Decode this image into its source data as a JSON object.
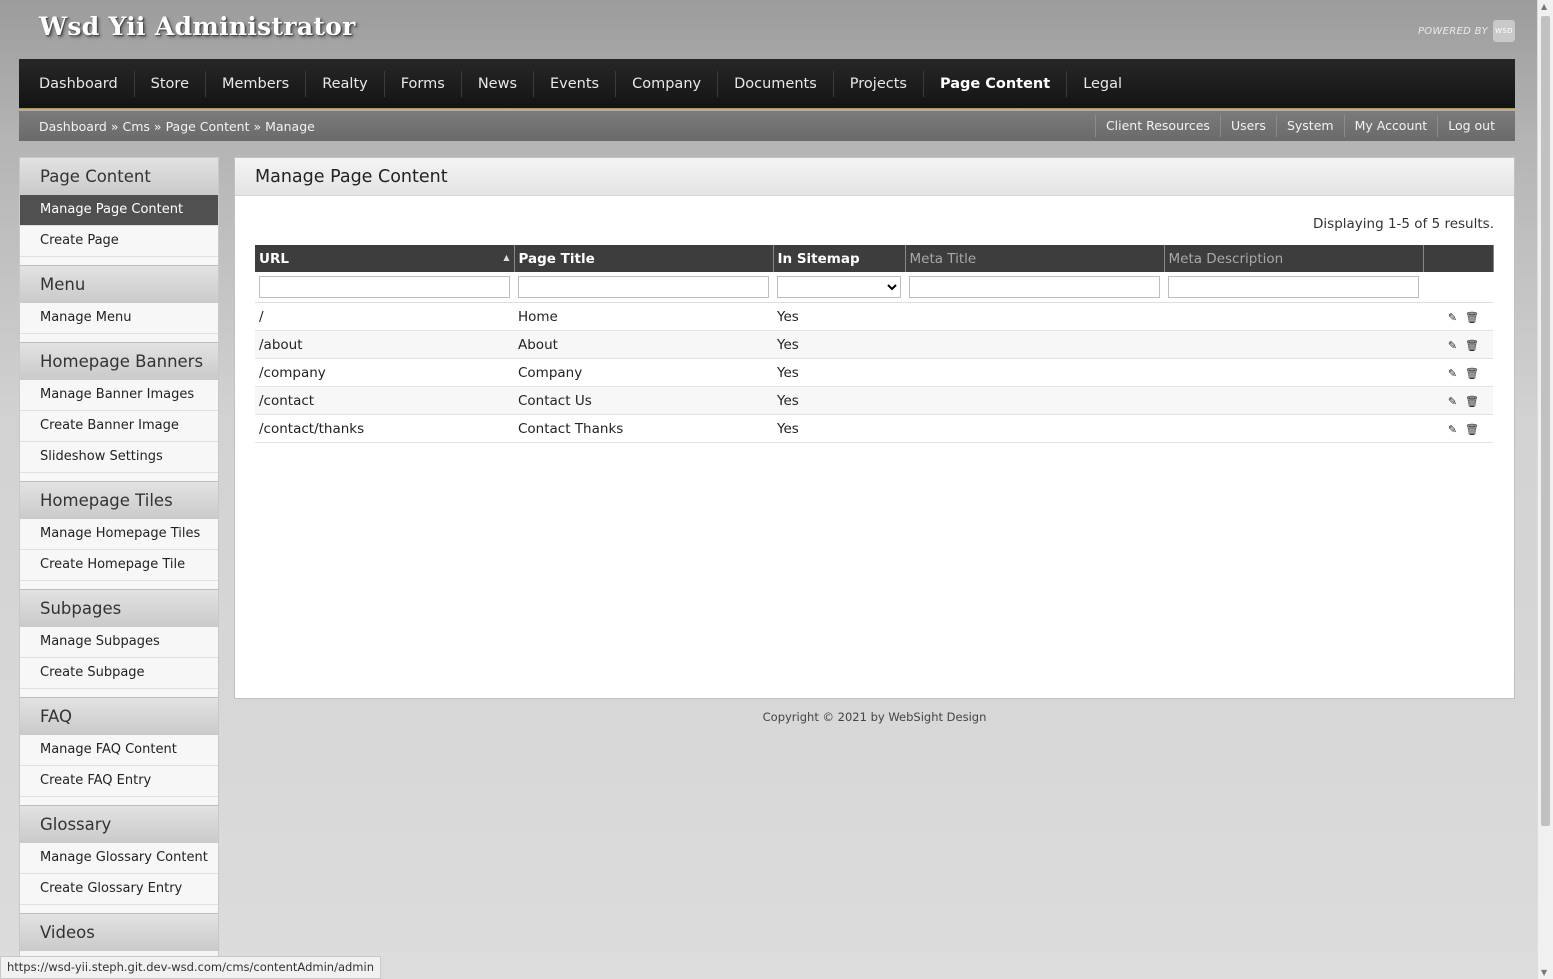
{
  "app": {
    "title": "Wsd Yii Administrator",
    "powered_by": "POWERED BY",
    "powered_logo": "WSD"
  },
  "main_nav": {
    "items": [
      "Dashboard",
      "Store",
      "Members",
      "Realty",
      "Forms",
      "News",
      "Events",
      "Company",
      "Documents",
      "Projects",
      "Page Content",
      "Legal"
    ],
    "active": "Page Content"
  },
  "breadcrumb": {
    "items": [
      "Dashboard",
      "Cms",
      "Page Content",
      "Manage"
    ],
    "separator": "»"
  },
  "util_links": [
    "Client Resources",
    "Users",
    "System",
    "My Account",
    "Log out"
  ],
  "sidebar": {
    "sections": [
      {
        "title": "Page Content",
        "items": [
          "Manage Page Content",
          "Create Page"
        ]
      },
      {
        "title": "Menu",
        "items": [
          "Manage Menu"
        ]
      },
      {
        "title": "Homepage Banners",
        "items": [
          "Manage Banner Images",
          "Create Banner Image",
          "Slideshow Settings"
        ]
      },
      {
        "title": "Homepage Tiles",
        "items": [
          "Manage Homepage Tiles",
          "Create Homepage Tile"
        ]
      },
      {
        "title": "Subpages",
        "items": [
          "Manage Subpages",
          "Create Subpage"
        ]
      },
      {
        "title": "FAQ",
        "items": [
          "Manage FAQ Content",
          "Create FAQ Entry"
        ]
      },
      {
        "title": "Glossary",
        "items": [
          "Manage Glossary Content",
          "Create Glossary Entry"
        ]
      },
      {
        "title": "Videos",
        "items": []
      }
    ],
    "active_item": "Manage Page Content"
  },
  "panel": {
    "title": "Manage Page Content",
    "summary": "Displaying 1-5 of 5 results."
  },
  "grid": {
    "columns": [
      "URL",
      "Page Title",
      "In Sitemap",
      "Meta Title",
      "Meta Description",
      ""
    ],
    "sorted_column": "URL",
    "rows": [
      [
        "/",
        "Home",
        "Yes",
        "",
        ""
      ],
      [
        "/about",
        "About",
        "Yes",
        "",
        ""
      ],
      [
        "/company",
        "Company",
        "Yes",
        "",
        ""
      ],
      [
        "/contact",
        "Contact Us",
        "Yes",
        "",
        ""
      ],
      [
        "/contact/thanks",
        "Contact Thanks",
        "Yes",
        "",
        ""
      ]
    ],
    "row_actions": [
      "pencil-icon",
      "trash-icon"
    ]
  },
  "footer": {
    "copyright": "Copyright © 2021 by WebSight Design"
  },
  "status_bar": {
    "url": "https://wsd-yii.steph.git.dev-wsd.com/cms/contentAdmin/admin"
  }
}
